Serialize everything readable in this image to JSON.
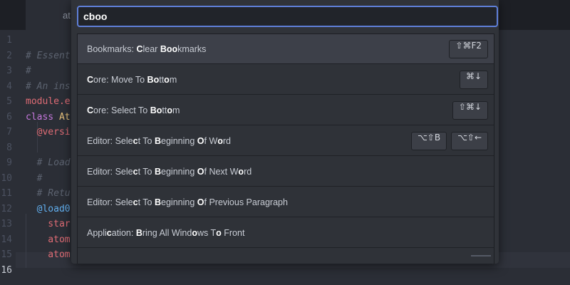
{
  "tab": {
    "title": "at"
  },
  "editor": {
    "lines": [
      {
        "num": "1",
        "segments": []
      },
      {
        "num": "2",
        "segments": [
          {
            "text": "# Essent",
            "color": "#5c6370",
            "italic": true
          }
        ]
      },
      {
        "num": "3",
        "segments": [
          {
            "text": "#",
            "color": "#5c6370",
            "italic": true
          }
        ]
      },
      {
        "num": "4",
        "segments": [
          {
            "text": "# An ins",
            "color": "#5c6370",
            "italic": true
          }
        ]
      },
      {
        "num": "5",
        "segments": [
          {
            "text": "module.e",
            "color": "#e06c75",
            "italic": false
          }
        ]
      },
      {
        "num": "6",
        "segments": [
          {
            "text": "class ",
            "color": "#c678dd",
            "italic": false
          },
          {
            "text": "At",
            "color": "#e5c07b",
            "italic": false
          }
        ]
      },
      {
        "num": "7",
        "segments": [
          {
            "text": "  @versi",
            "color": "#e06c75",
            "italic": false
          }
        ]
      },
      {
        "num": "8",
        "segments": []
      },
      {
        "num": "9",
        "segments": [
          {
            "text": "  # Load",
            "color": "#5c6370",
            "italic": true
          }
        ]
      },
      {
        "num": "10",
        "segments": [
          {
            "text": "  #",
            "color": "#5c6370",
            "italic": true
          }
        ]
      },
      {
        "num": "11",
        "segments": [
          {
            "text": "  # Retu",
            "color": "#5c6370",
            "italic": true
          }
        ]
      },
      {
        "num": "12",
        "segments": [
          {
            "text": "  @load0",
            "color": "#61afef",
            "italic": false
          }
        ]
      },
      {
        "num": "13",
        "segments": [
          {
            "text": "    star",
            "color": "#e06c75",
            "italic": false
          }
        ]
      },
      {
        "num": "14",
        "segments": [
          {
            "text": "    atom",
            "color": "#e06c75",
            "italic": false
          }
        ]
      },
      {
        "num": "15",
        "segments": [
          {
            "text": "    atom",
            "color": "#e06c75",
            "italic": false
          }
        ]
      },
      {
        "num": "16",
        "segments": [],
        "active": true
      }
    ]
  },
  "palette": {
    "query": "cboo",
    "results": [
      {
        "parts": [
          [
            "Bookmarks: ",
            false
          ],
          [
            "C",
            true
          ],
          [
            "lear ",
            false
          ],
          [
            "Boo",
            true
          ],
          [
            "kmarks",
            false
          ]
        ],
        "keys": [
          "⇧⌘F2"
        ],
        "selected": true
      },
      {
        "parts": [
          [
            "C",
            true
          ],
          [
            "ore: Move To ",
            false
          ],
          [
            "Bo",
            true
          ],
          [
            "tt",
            false
          ],
          [
            "o",
            true
          ],
          [
            "m",
            false
          ]
        ],
        "keys": [
          "⌘↓"
        ]
      },
      {
        "parts": [
          [
            "C",
            true
          ],
          [
            "ore: Select To ",
            false
          ],
          [
            "Bo",
            true
          ],
          [
            "tt",
            false
          ],
          [
            "o",
            true
          ],
          [
            "m",
            false
          ]
        ],
        "keys": [
          "⇧⌘↓"
        ]
      },
      {
        "parts": [
          [
            "Editor: Sele",
            false
          ],
          [
            "c",
            true
          ],
          [
            "t To ",
            false
          ],
          [
            "B",
            true
          ],
          [
            "eginning ",
            false
          ],
          [
            "O",
            true
          ],
          [
            "f W",
            false
          ],
          [
            "o",
            true
          ],
          [
            "rd",
            false
          ]
        ],
        "keys": [
          "⌥⇧B",
          "⌥⇧←"
        ]
      },
      {
        "parts": [
          [
            "Editor: Sele",
            false
          ],
          [
            "c",
            true
          ],
          [
            "t To ",
            false
          ],
          [
            "B",
            true
          ],
          [
            "eginning ",
            false
          ],
          [
            "O",
            true
          ],
          [
            "f Next W",
            false
          ],
          [
            "o",
            true
          ],
          [
            "rd",
            false
          ]
        ],
        "keys": []
      },
      {
        "parts": [
          [
            "Editor: Sele",
            false
          ],
          [
            "c",
            true
          ],
          [
            "t To ",
            false
          ],
          [
            "B",
            true
          ],
          [
            "eginning ",
            false
          ],
          [
            "O",
            true
          ],
          [
            "f Previous Paragraph",
            false
          ]
        ],
        "keys": []
      },
      {
        "parts": [
          [
            "Appli",
            false
          ],
          [
            "c",
            true
          ],
          [
            "ation: ",
            false
          ],
          [
            "B",
            true
          ],
          [
            "ring All Wind",
            false
          ],
          [
            "o",
            true
          ],
          [
            "ws T",
            false
          ],
          [
            "o",
            true
          ],
          [
            " Front",
            false
          ]
        ],
        "keys": []
      }
    ]
  }
}
